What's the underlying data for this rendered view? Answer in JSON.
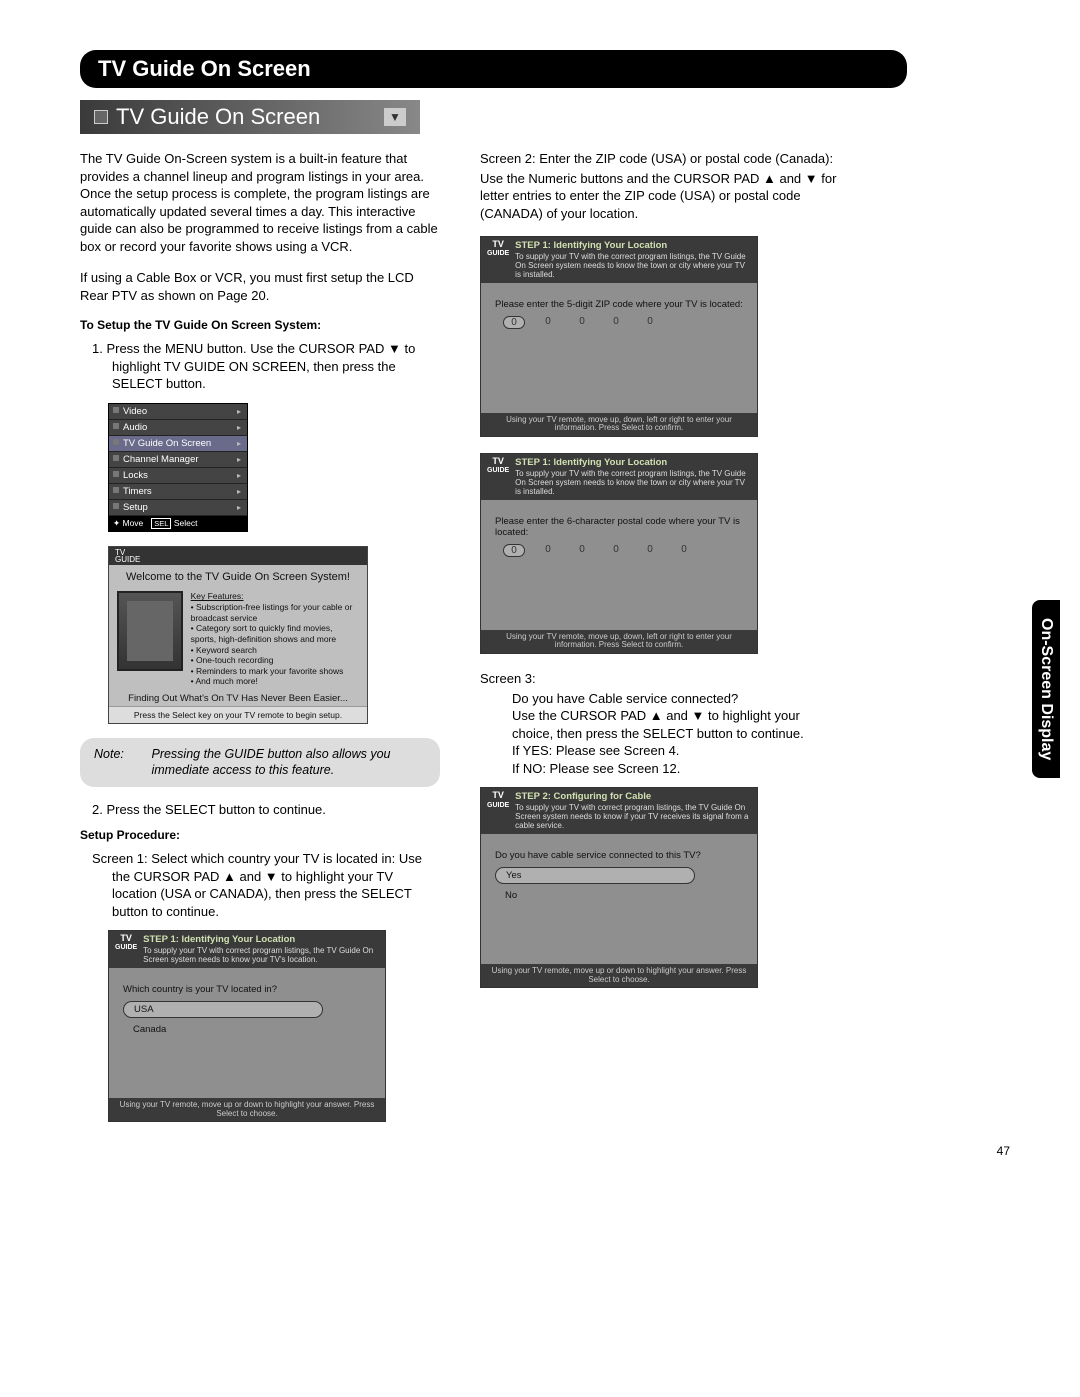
{
  "section_title": "TV Guide On Screen",
  "title_bar": "TV Guide On Screen",
  "side_tab": "On-Screen Display",
  "page_number": "47",
  "left": {
    "intro": "The TV Guide On-Screen system is a built-in feature that provides a channel lineup and program listings in your area.  Once the setup process is complete, the program listings are automatically updated several times a day.  This interactive guide can also be programmed to receive listings from a cable box or record your favorite shows using a VCR.",
    "intro2": "If using a Cable Box or VCR, you must first setup the LCD Rear PTV as shown on Page 20.",
    "setup_head": "To Setup the TV Guide On Screen System:",
    "step1": "1.   Press the MENU button.  Use the CURSOR PAD ▼ to highlight TV GUIDE ON SCREEN, then press the SELECT button.",
    "menu_items": [
      "Video",
      "Audio",
      "TV Guide On Screen",
      "Channel Manager",
      "Locks",
      "Timers",
      "Setup"
    ],
    "menu_foot_move": "Move",
    "menu_foot_sel_box": "SEL",
    "menu_foot_sel": "Select",
    "welcome": {
      "title": "Welcome to the TV Guide On Screen System!",
      "feat_head": "Key Features:",
      "feats": [
        "• Subscription-free listings for your cable or broadcast service",
        "• Category sort to quickly find movies, sports, high-definition shows and more",
        "• Keyword search",
        "• One-touch recording",
        "• Reminders to mark your favorite shows",
        "• And much more!"
      ],
      "foot1": "Finding Out What's On TV Has Never Been Easier...",
      "foot2": "Press the Select key on your TV remote to begin setup."
    },
    "note_label": "Note:",
    "note_text": "Pressing the GUIDE button also allows you immediate access to this feature.",
    "step2": "2.   Press the SELECT button to continue.",
    "proc_head": "Setup Procedure:",
    "screen1": "Screen 1:  Select which country your TV is located in: Use the CURSOR PAD ▲ and ▼ to highlight your TV location (USA or CANADA), then press the SELECT button to continue.",
    "wiz1": {
      "title": "STEP 1: Identifying Your Location",
      "desc": "To supply your TV with correct program listings, the TV Guide On Screen system needs to know your TV's location.",
      "prompt": "Which country is your TV located in?",
      "opts": [
        "USA",
        "Canada"
      ],
      "foot": "Using your TV remote, move up or down to highlight your answer.  Press Select to choose."
    }
  },
  "right": {
    "screen2_intro": "Screen 2:  Enter the ZIP code (USA) or postal code (Canada):",
    "screen2_body": "Use the Numeric buttons and the CURSOR PAD ▲ and ▼ for letter entries to enter the ZIP code (USA) or postal code (CANADA) of your location.",
    "wiz2a": {
      "title": "STEP 1: Identifying Your Location",
      "desc": "To supply your TV with the correct program listings, the TV Guide On Screen system needs to know the town or city where your TV is installed.",
      "prompt": "Please enter the 5-digit ZIP code where your TV is located:",
      "slots": 5,
      "foot": "Using your TV remote, move up, down, left or right to enter your information.  Press Select to confirm."
    },
    "wiz2b": {
      "title": "STEP 1: Identifying Your Location",
      "desc": "To supply your TV with the correct program listings, the TV Guide On Screen system needs to know the town or city where your TV is installed.",
      "prompt": "Please enter the 6-character postal code where your TV is located:",
      "slots": 6,
      "foot": "Using your TV remote, move up, down, left or right to enter your information.  Press Select to confirm."
    },
    "screen3_head": "Screen 3:",
    "screen3_body": "Do you have Cable service connected?\nUse the CURSOR PAD ▲ and ▼ to highlight your choice, then press the SELECT button to continue.\nIf YES:  Please see Screen 4.\nIf NO:  Please see Screen 12.",
    "wiz3": {
      "title": "STEP 2: Configuring for Cable",
      "desc": "To supply your TV with correct program listings, the TV Guide On Screen system needs to know if your TV receives its signal from a cable service.",
      "prompt": "Do you have cable service connected to this TV?",
      "opts": [
        "Yes",
        "No"
      ],
      "foot": "Using your TV remote, move up or down to highlight your answer.  Press Select to choose."
    }
  },
  "tvguide_logo_top": "TV",
  "tvguide_logo_bot": "GUIDE"
}
